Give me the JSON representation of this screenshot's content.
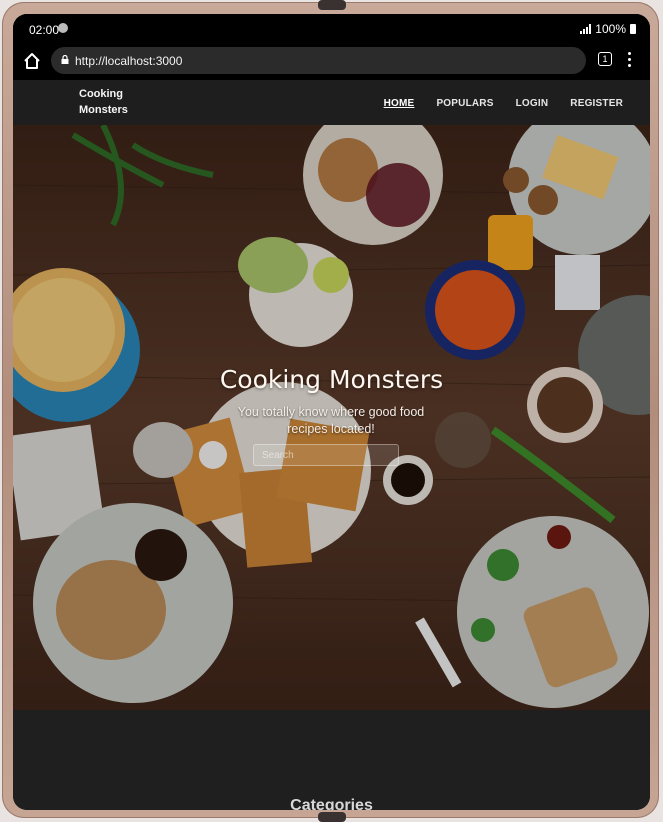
{
  "status": {
    "time": "02:00",
    "battery": "100%"
  },
  "browser": {
    "url": "http://localhost:3000",
    "tab_count": "1"
  },
  "nav": {
    "brand": "Cooking Monsters",
    "links": [
      "HOME",
      "POPULARS",
      "LOGIN",
      "REGISTER"
    ]
  },
  "hero": {
    "title": "Cooking Monsters",
    "subtitle": "You totally know where good food recipes located!",
    "search_placeholder": "Search"
  },
  "section": {
    "categories": "Categories"
  },
  "colors": {
    "accent_orange": "#f0a21e",
    "wood": "#4a2f22",
    "navbar": "#1e1e1e"
  },
  "icons": [
    "home-icon",
    "lock-icon",
    "tabs-icon",
    "menu-icon",
    "spotify-icon",
    "signal-icon",
    "battery-icon"
  ]
}
